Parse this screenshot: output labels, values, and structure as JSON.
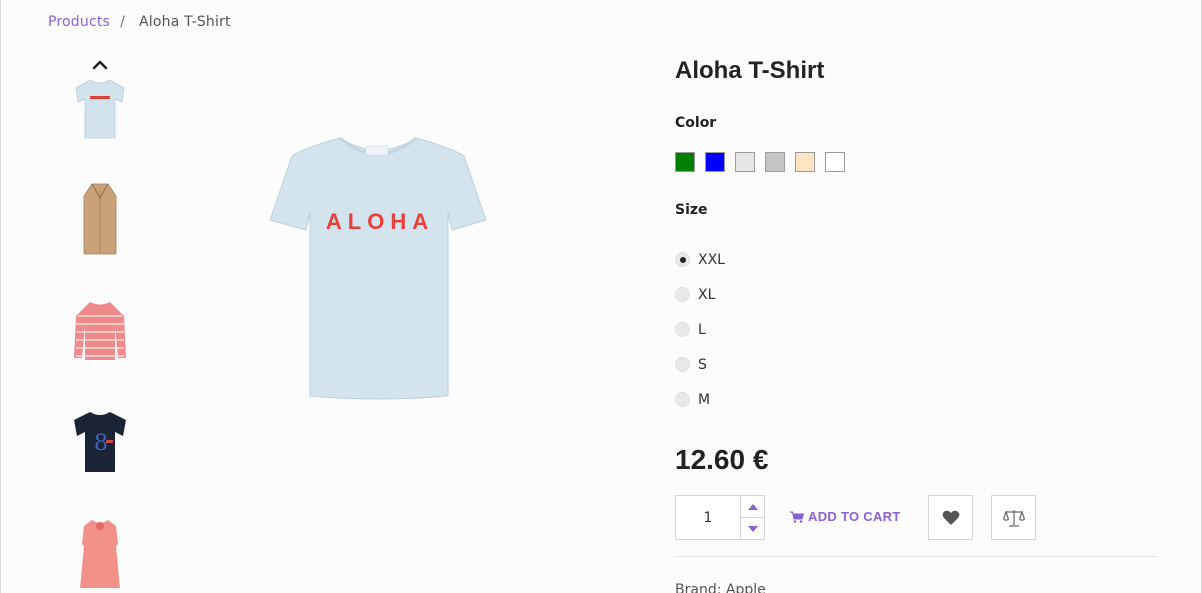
{
  "breadcrumb": {
    "link_label": "Products",
    "separator": "/",
    "current": "Aloha T-Shirt"
  },
  "thumbnails": [
    {
      "name": "aloha-tshirt-thumbnail",
      "icon": "tshirt-icon"
    },
    {
      "name": "camel-coat-thumbnail",
      "icon": "coat-icon"
    },
    {
      "name": "striped-top-thumbnail",
      "icon": "top-icon"
    },
    {
      "name": "navy-tshirt-thumbnail",
      "icon": "tshirt-icon"
    },
    {
      "name": "pink-dress-thumbnail",
      "icon": "dress-icon"
    }
  ],
  "main_image": {
    "text": "ALOHA"
  },
  "product": {
    "title": "Aloha T-Shirt",
    "color_label": "Color",
    "colors": [
      "#008000",
      "#0000ff",
      "#e6e6e6",
      "#c4c4c4",
      "#ffe4c4",
      "#ffffff"
    ],
    "size_label": "Size",
    "sizes": [
      {
        "label": "XXL",
        "selected": true
      },
      {
        "label": "XL",
        "selected": false
      },
      {
        "label": "L",
        "selected": false
      },
      {
        "label": "S",
        "selected": false
      },
      {
        "label": "M",
        "selected": false
      }
    ],
    "price": "12.60 €",
    "quantity": "1",
    "add_to_cart_label": "ADD TO CART",
    "brand_line": "Brand: Apple"
  },
  "colors": {
    "accent": "#8a63d2",
    "border": "#d6d6d6"
  }
}
